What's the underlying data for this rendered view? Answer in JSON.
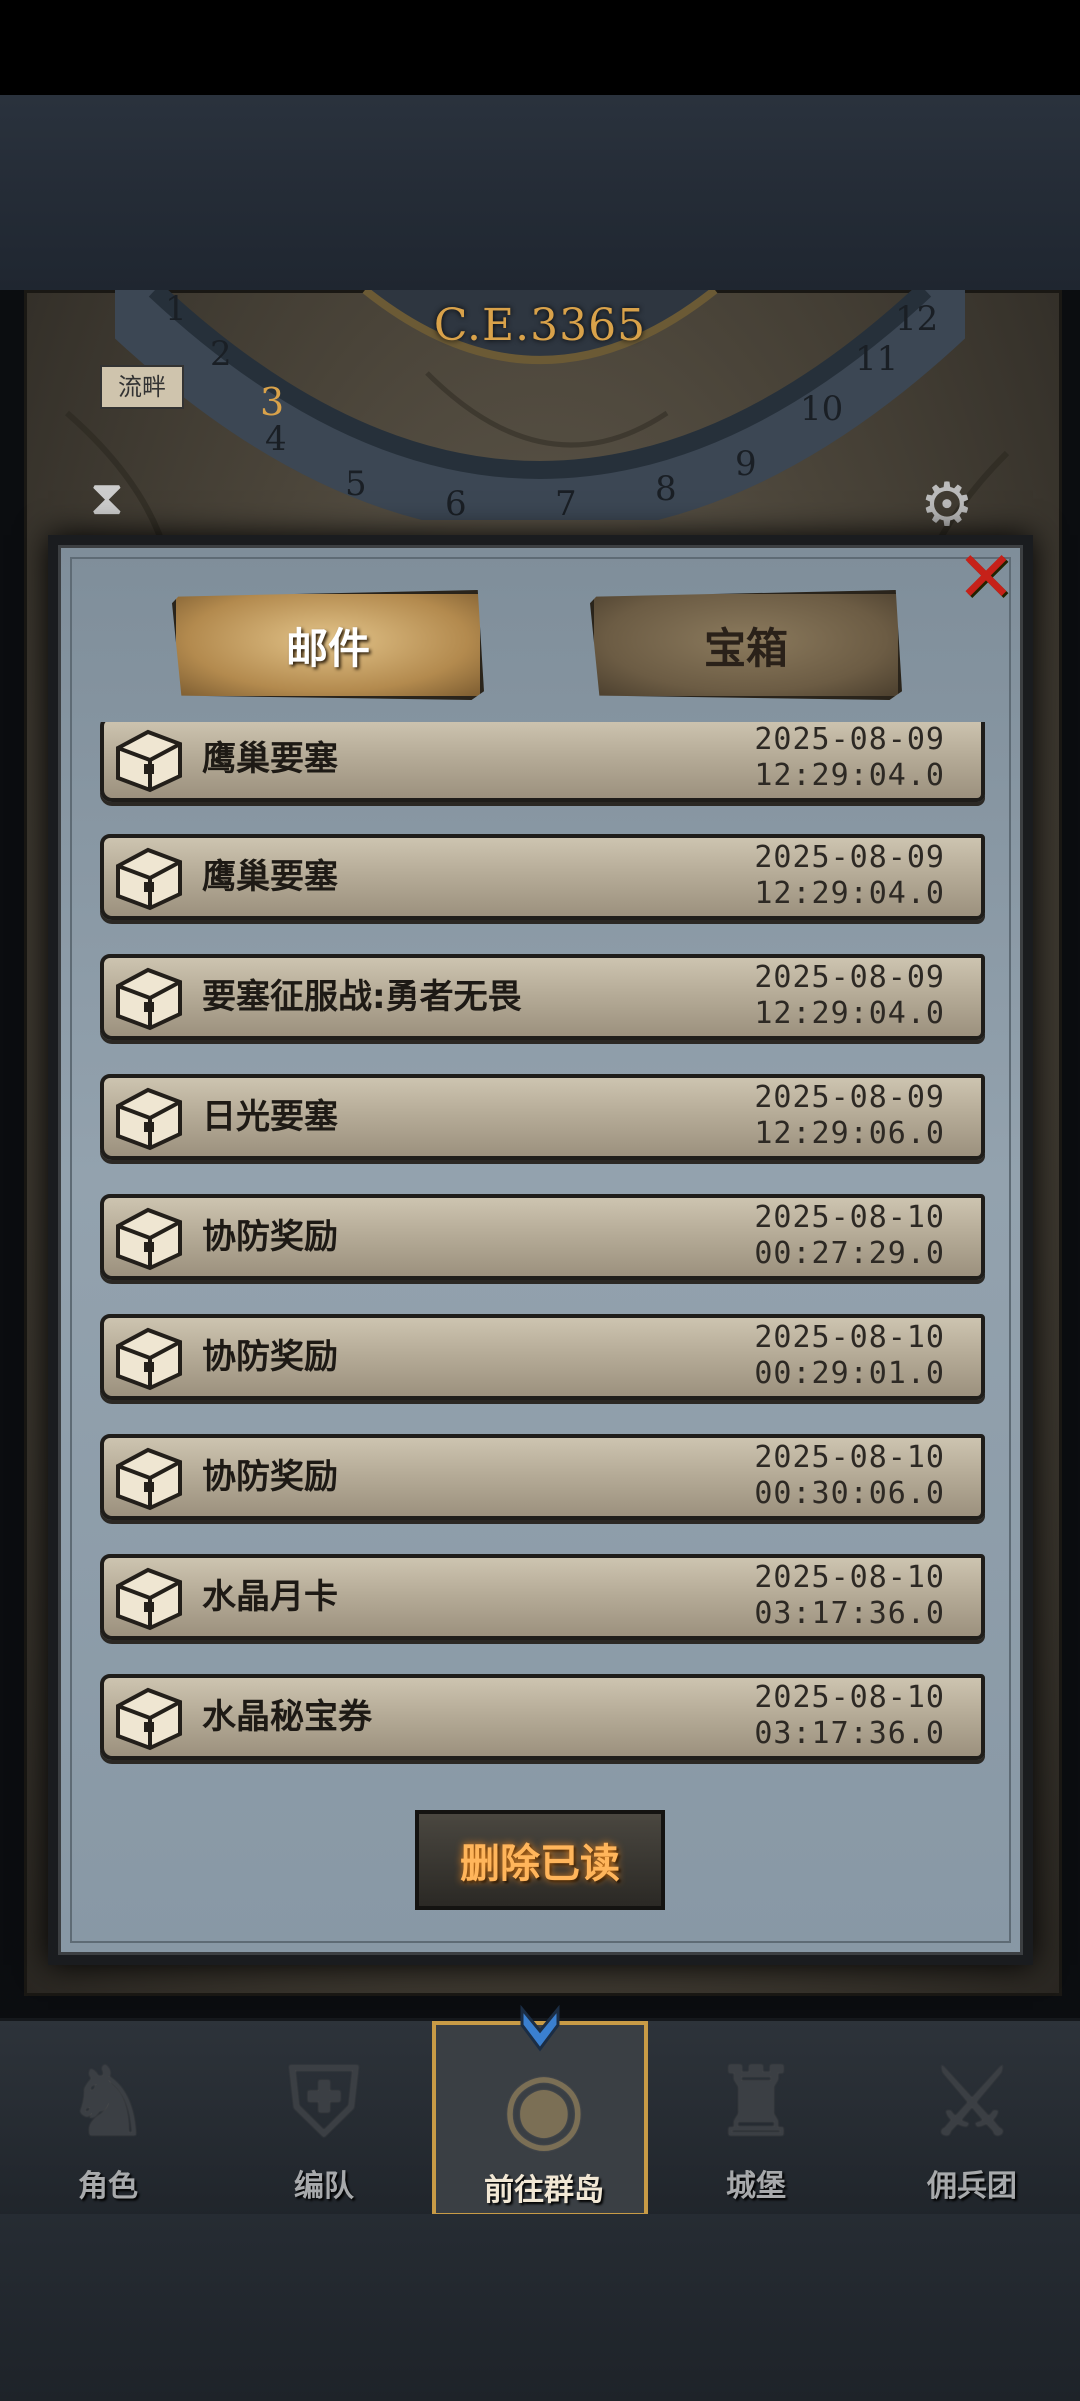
{
  "header": {
    "era_label": "C.E.3365",
    "location_tag": "流畔"
  },
  "tabs": [
    {
      "label": "邮件",
      "active": true
    },
    {
      "label": "宝箱",
      "active": false
    }
  ],
  "mail_list": [
    {
      "title": "鹰巢要塞",
      "date": "2025-08-09",
      "time": "12:29:04.0"
    },
    {
      "title": "鹰巢要塞",
      "date": "2025-08-09",
      "time": "12:29:04.0"
    },
    {
      "title": "要塞征服战:勇者无畏",
      "date": "2025-08-09",
      "time": "12:29:04.0"
    },
    {
      "title": "日光要塞",
      "date": "2025-08-09",
      "time": "12:29:06.0"
    },
    {
      "title": "协防奖励",
      "date": "2025-08-10",
      "time": "00:27:29.0"
    },
    {
      "title": "协防奖励",
      "date": "2025-08-10",
      "time": "00:29:01.0"
    },
    {
      "title": "协防奖励",
      "date": "2025-08-10",
      "time": "00:30:06.0"
    },
    {
      "title": "水晶月卡",
      "date": "2025-08-10",
      "time": "03:17:36.0"
    },
    {
      "title": "水晶秘宝券",
      "date": "2025-08-10",
      "time": "03:17:36.0"
    }
  ],
  "actions": {
    "delete_read_label": "删除已读"
  },
  "bottom_nav": [
    {
      "label": "角色",
      "icon": "knight-icon"
    },
    {
      "label": "编队",
      "icon": "helmet-icon"
    },
    {
      "label": "前往群岛",
      "icon": "globe-icon",
      "active": true
    },
    {
      "label": "城堡",
      "icon": "castle-icon"
    },
    {
      "label": "佣兵团",
      "icon": "mercenary-icon"
    }
  ],
  "colors": {
    "accent_gold": "#d9a24a",
    "close_red": "#c62119",
    "delete_text": "#ffb55b",
    "active_nav_border": "#c89b46"
  }
}
